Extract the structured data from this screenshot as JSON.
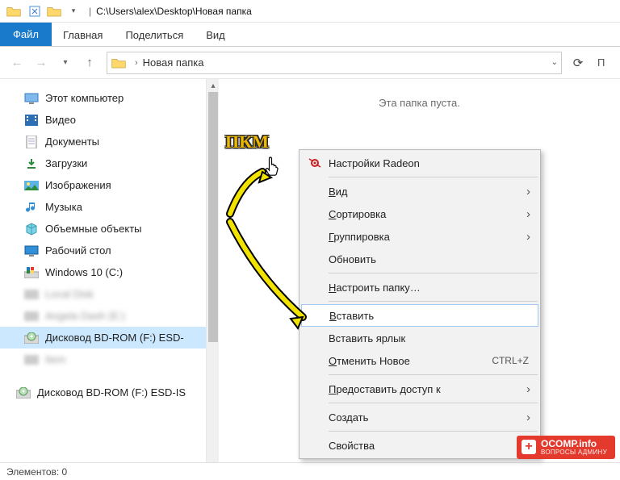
{
  "window": {
    "title_path": "C:\\Users\\alex\\Desktop\\Новая папка"
  },
  "ribbon": {
    "file": "Файл",
    "home": "Главная",
    "share": "Поделиться",
    "view": "Вид"
  },
  "address": {
    "crumb": "Новая папка"
  },
  "search_fragment": "П",
  "sidebar": {
    "this_pc": "Этот компьютер",
    "videos": "Видео",
    "documents": "Документы",
    "downloads": "Загрузки",
    "pictures": "Изображения",
    "music": "Музыка",
    "objects3d": "Объемные объекты",
    "desktop": "Рабочий стол",
    "drive_c": "Windows 10 (C:)",
    "blurred1": "Local Disk",
    "blurred2": "Angela Dash (E:)",
    "bdrom": "Дисковод BD-ROM (F:) ESD-",
    "blurred3": "Item",
    "bdrom2": "Дисковод BD-ROM (F:) ESD-IS"
  },
  "content": {
    "empty": "Эта папка пуста."
  },
  "context_menu": {
    "radeon": "Настройки Radeon",
    "view": "Вид",
    "sort": "Сортировка",
    "group": "Группировка",
    "refresh": "Обновить",
    "customize": "Настроить папку…",
    "paste": "Вставить",
    "paste_shortcut": "Вставить ярлык",
    "undo": "Отменить Новое",
    "undo_key": "CTRL+Z",
    "share_access": "Предоставить доступ к",
    "new": "Создать",
    "properties": "Свойства"
  },
  "status": {
    "elements": "Элементов: 0"
  },
  "annotation": {
    "label": "ПКМ"
  },
  "watermark": {
    "main": "OCOMP.info",
    "sub": "ВОПРОСЫ АДМИНУ"
  }
}
